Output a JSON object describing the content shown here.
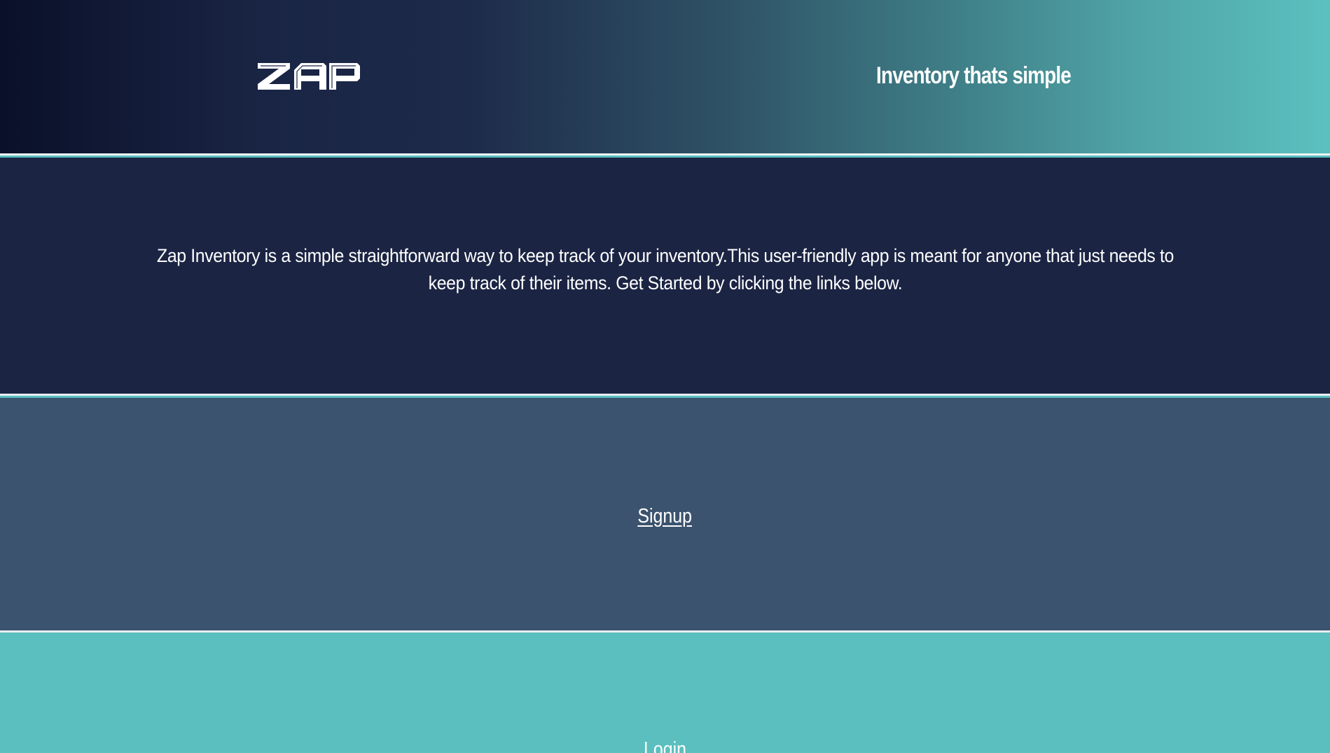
{
  "header": {
    "logo_text": "ZAP",
    "tagline": "Inventory thats simple"
  },
  "intro": {
    "text": "Zap Inventory is a simple straightforward way to keep track of your inventory.This user-friendly app is meant for anyone that just needs to keep track of their items. Get Started by clicking the links below."
  },
  "links": {
    "signup": "Signup",
    "login": "Login"
  },
  "colors": {
    "header_gradient_start": "#0a1029",
    "header_gradient_end": "#5bc1bf",
    "intro_bg": "#1b2443",
    "signup_bg": "#3b536e",
    "login_bg": "#5bbfbf",
    "divider": "#e9eef0"
  }
}
